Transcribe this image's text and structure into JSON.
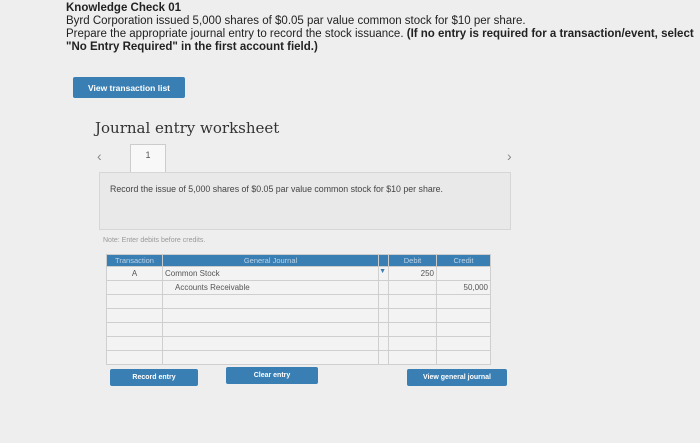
{
  "header": {
    "title": "Knowledge Check 01",
    "line1": "Byrd Corporation issued 5,000 shares of $0.05 par value common stock for $10 per share.",
    "line2": "Prepare the appropriate journal entry to record the stock issuance.",
    "instruction": "(If no entry is required for a transaction/event, select \"No Entry Required\" in the first account field.)"
  },
  "view_transaction_list_label": "View transaction list",
  "worksheet": {
    "title": "Journal entry worksheet",
    "prev_icon": "‹",
    "next_icon": "›",
    "tab_label": "1",
    "description": "Record the issue of 5,000 shares of $0.05 par value common stock for $10 per share.",
    "note": "Note: Enter debits before credits."
  },
  "journal": {
    "headers": [
      "Transaction",
      "General Journal",
      "",
      "Debit",
      "Credit"
    ],
    "rows": [
      {
        "transaction": "A",
        "account": "Common Stock",
        "debit": "250",
        "credit": ""
      },
      {
        "transaction": "",
        "account": "Accounts Receivable",
        "debit": "",
        "credit": "50,000"
      },
      {
        "transaction": "",
        "account": "",
        "debit": "",
        "credit": ""
      },
      {
        "transaction": "",
        "account": "",
        "debit": "",
        "credit": ""
      },
      {
        "transaction": "",
        "account": "",
        "debit": "",
        "credit": ""
      },
      {
        "transaction": "",
        "account": "",
        "debit": "",
        "credit": ""
      },
      {
        "transaction": "",
        "account": "",
        "debit": "",
        "credit": ""
      }
    ]
  },
  "buttons": {
    "record": "Record entry",
    "clear": "Clear entry",
    "view_journal": "View general journal"
  }
}
